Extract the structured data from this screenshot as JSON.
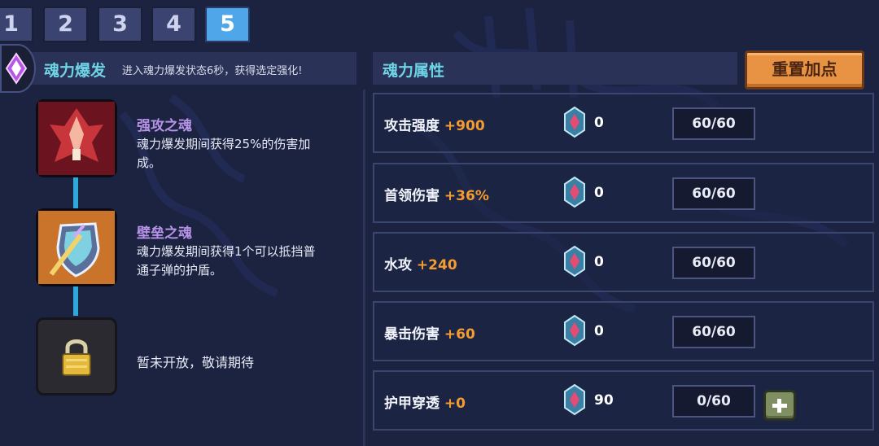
{
  "tabs": [
    {
      "label": "1",
      "active": false
    },
    {
      "label": "2",
      "active": false
    },
    {
      "label": "3",
      "active": false
    },
    {
      "label": "4",
      "active": false
    },
    {
      "label": "5",
      "active": true
    }
  ],
  "burst": {
    "icon": "soul-burst-crystal-icon",
    "title": "魂力爆发",
    "description": "进入魂力爆发状态6秒，获得选定强化!"
  },
  "souls": [
    {
      "icon": "power-soul-icon",
      "name": "强攻之魂",
      "desc_line1": "魂力爆发期间获得25%的伤害加",
      "desc_line2": "成。"
    },
    {
      "icon": "bulwark-soul-icon",
      "name": "壁垒之魂",
      "desc_line1": "魂力爆发期间获得1个可以抵挡普",
      "desc_line2": "通子弹的护盾。"
    },
    {
      "icon": "lock-icon",
      "locked_text": "暂未开放，敬请期待"
    }
  ],
  "attributes": {
    "title": "魂力属性",
    "reset_label": "重置加点",
    "rows": [
      {
        "label": "攻击强度",
        "bonus": "+900",
        "gems": "0",
        "level": "60/60",
        "can_add": false
      },
      {
        "label": "首领伤害",
        "bonus": "+36%",
        "gems": "0",
        "level": "60/60",
        "can_add": false
      },
      {
        "label": "水攻",
        "bonus": "+240",
        "gems": "0",
        "level": "60/60",
        "can_add": false
      },
      {
        "label": "暴击伤害",
        "bonus": "+60",
        "gems": "0",
        "level": "60/60",
        "can_add": false
      },
      {
        "label": "护甲穿透",
        "bonus": "+0",
        "gems": "90",
        "level": "0/60",
        "can_add": true
      }
    ]
  },
  "colors": {
    "accent_title": "#6fd4e6",
    "bonus": "#f59b2f",
    "soul_name": "#b693e8",
    "reset_button": "#e89343",
    "active_tab": "#4fa6e8"
  }
}
